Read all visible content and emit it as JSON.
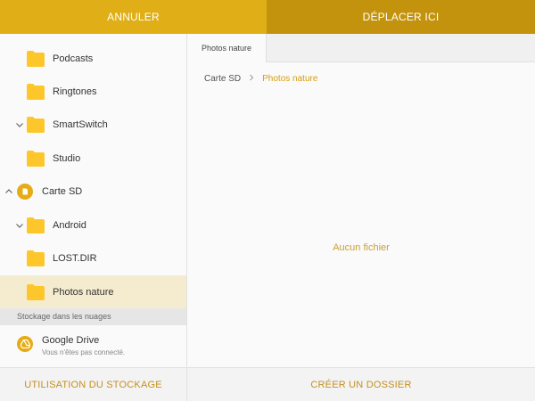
{
  "topbar": {
    "cancel_label": "ANNULER",
    "move_label": "DÉPLACER ICI"
  },
  "sidebar": {
    "tree": [
      {
        "label": "Podcasts",
        "type": "folder",
        "chevron": ""
      },
      {
        "label": "Ringtones",
        "type": "folder",
        "chevron": ""
      },
      {
        "label": "SmartSwitch",
        "type": "folder",
        "chevron": "expanded"
      },
      {
        "label": "Studio",
        "type": "folder",
        "chevron": ""
      },
      {
        "label": "Carte SD",
        "type": "sd-card",
        "chevron": "collapsed-up"
      },
      {
        "label": "Android",
        "type": "folder",
        "chevron": "expanded"
      },
      {
        "label": "LOST.DIR",
        "type": "folder",
        "chevron": ""
      },
      {
        "label": "Photos nature",
        "type": "folder",
        "chevron": "",
        "selected": true
      }
    ],
    "cloud_header": "Stockage dans les nuages",
    "drive": {
      "title": "Google Drive",
      "subtitle": "Vous n'êtes pas connecté."
    }
  },
  "main": {
    "tab_label": "Photos nature",
    "breadcrumb": {
      "root": "Carte SD",
      "current": "Photos nature"
    },
    "empty_message": "Aucun fichier"
  },
  "bottom": {
    "storage_label": "UTILISATION DU STOCKAGE",
    "create_label": "CRÉER UN DOSSIER"
  },
  "colors": {
    "accent": "#e0ae17",
    "accent_dark": "#c4930e",
    "folder": "#fdc72c",
    "selected_bg": "#f5ecd0"
  }
}
